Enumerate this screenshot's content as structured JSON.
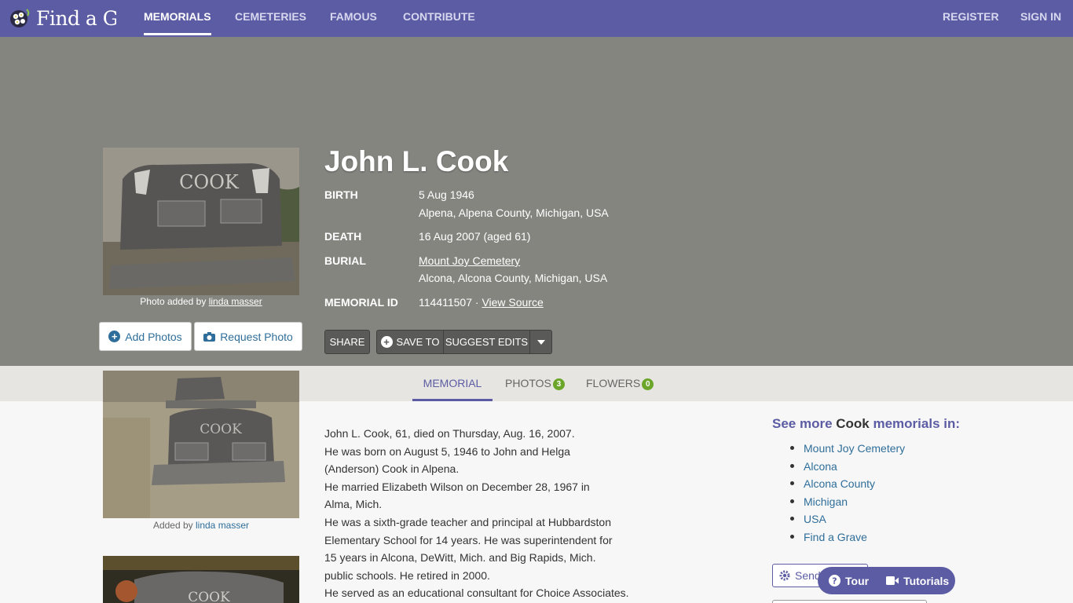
{
  "header": {
    "logo_text": "Find a Grave",
    "nav": [
      "MEMORIALS",
      "CEMETERIES",
      "FAMOUS",
      "CONTRIBUTE"
    ],
    "register": "REGISTER",
    "sign_in": "SIGN IN"
  },
  "memorial": {
    "name": "John L. Cook",
    "photo_caption_prefix": "Photo added by ",
    "photo_caption_user": "linda masser",
    "add_photos": "Add Photos",
    "request_photo": "Request Photo",
    "stone_text": "COOK",
    "facts": {
      "birth_label": "BIRTH",
      "birth_date": "5 Aug 1946",
      "birth_place": "Alpena, Alpena County, Michigan, USA",
      "death_label": "DEATH",
      "death_date": "16 Aug 2007 (aged 61)",
      "burial_label": "BURIAL",
      "burial_cemetery": "Mount Joy Cemetery",
      "burial_place": "Alcona, Alcona County, Michigan, USA",
      "id_label": "MEMORIAL ID",
      "id_value": "114411507 · ",
      "view_source": "View Source"
    },
    "actions": {
      "share": "SHARE",
      "save_to": "SAVE TO",
      "suggest_edits": "SUGGEST EDITS"
    }
  },
  "tabs": {
    "memorial": "MEMORIAL",
    "photos": "PHOTOS",
    "photos_count": "3",
    "flowers": "FLOWERS",
    "flowers_count": "0"
  },
  "left_photos": {
    "caption_prefix": "Added by ",
    "caption_user": "linda masser"
  },
  "bio": {
    "lines": [
      "John L. Cook, 61, died on Thursday, Aug. 16, 2007.",
      "He was born on August 5, 1946 to John and Helga",
      "(Anderson) Cook in Alpena.",
      "He married Elizabeth Wilson on December 28, 1967 in",
      "Alma, Mich.",
      "He was a sixth-grade teacher and principal at Hubbardston",
      "Elementary School for 14 years. He was superintendent for",
      "15 years in Alcona, DeWitt, Mich. and Big Rapids, Mich.",
      "public schools. He retired in 2000.",
      "He served as an educational consultant for Choice Associates."
    ]
  },
  "sidebar": {
    "see_more_prefix": "See more ",
    "see_more_name": "Cook",
    "see_more_suffix": " memorials in:",
    "links": [
      "Mount Joy Cemetery",
      "Alcona",
      "Alcona County",
      "Michigan",
      "USA",
      "Find a Grave"
    ],
    "send_label": "Send",
    "tour_label": "Tour",
    "tutorials_label": "Tutorials"
  },
  "colors": {
    "brand": "#5c5ca4",
    "hero_bg": "#858580",
    "badge_green": "#6ba52a",
    "link_blue": "#2f6e9a"
  }
}
